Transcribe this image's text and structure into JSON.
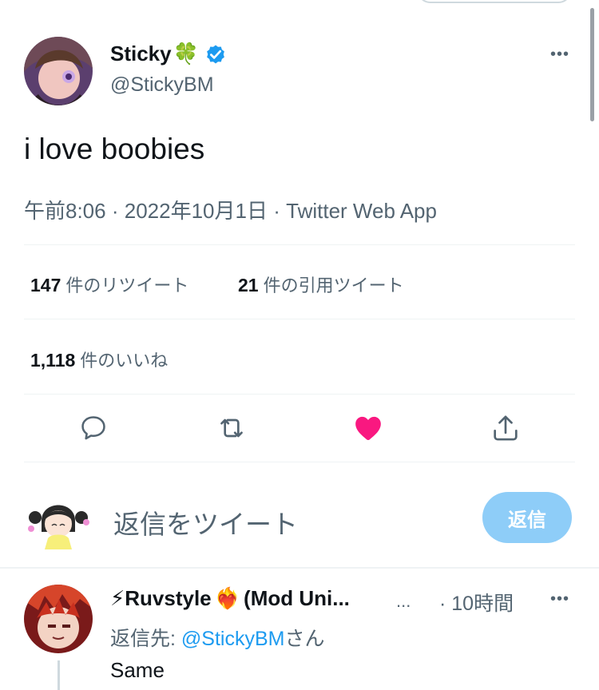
{
  "tweet": {
    "author_name": "Sticky",
    "author_emoji": "🍀",
    "handle": "@StickyBM",
    "text": "i love boobies",
    "time": "午前8:06",
    "date": "2022年10月1日",
    "separator": "·",
    "source": "Twitter Web App",
    "more": "•••",
    "retweets_count": "147",
    "retweets_label": "件のリツイート",
    "quotes_count": "21",
    "quotes_label": "件の引用ツイート",
    "likes_count": "1,118",
    "likes_label": "件のいいね"
  },
  "actions": {
    "reply_icon": "comment-icon",
    "retweet_icon": "retweet-icon",
    "like_icon": "heart-icon",
    "share_icon": "share-icon",
    "liked": true
  },
  "compose": {
    "placeholder": "返信をツイート",
    "button": "返信"
  },
  "reply": {
    "emoji_prefix": "⚡",
    "author_name": "Ruvstyle",
    "emoji_suffix": "❤️‍🔥",
    "name_rest": "(Mod Uni...",
    "name_ellipsis": "...",
    "dot": "·",
    "time": "10時間",
    "more": "•••",
    "reply_to_prefix": "返信先: ",
    "reply_to_handle": "@StickyBM",
    "reply_to_suffix": "さん",
    "text": "Same"
  },
  "colors": {
    "accent": "#1d9bf0",
    "like": "#f91880",
    "reply_button": "#8ecdf8",
    "secondary_text": "#536471"
  }
}
